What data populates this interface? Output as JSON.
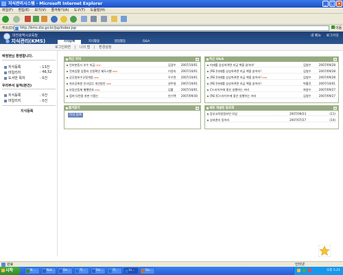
{
  "window": {
    "title": "지식관리시스템 - Microsoft Internet Explorer"
  },
  "menu": [
    "파일(F)",
    "편집(E)",
    "보기(V)",
    "즐겨찾기(A)",
    "도구(T)",
    "도움말(H)"
  ],
  "address": {
    "label": "주소(D)",
    "url": "http://kms.dio.go.kr/jsp/index.jsp",
    "go": "이동"
  },
  "header": {
    "org": "대전광역시교육청",
    "title": "지식관리(KMS)",
    "toplinks": [
      "내 메뉴",
      "로그아웃"
    ],
    "tabs": [
      "지식등록",
      "지식활용",
      "협업활동",
      "Q&A"
    ]
  },
  "subnav": [
    "로그인화면",
    "나의 맵",
    "환경설정"
  ],
  "left": {
    "greeting": "박정현님 환영합니다.",
    "stats": [
      {
        "label": "지식등록",
        "value": ": 13건"
      },
      {
        "label": "마일리지",
        "value": ": 46,52"
      },
      {
        "label": "도서반 목차",
        "value": ": 0건"
      }
    ],
    "section2": "우리부서 실적(본건)",
    "stats2": [
      {
        "label": "지식등록",
        "value": ": 0건"
      },
      {
        "label": "마일리지",
        "value": ": 0건"
      }
    ],
    "button": "지식등록"
  },
  "panels": {
    "recent_knowledge": {
      "title": "최근 지식",
      "rows": [
        {
          "title": "인보본동시 부수 지급",
          "new": "new",
          "author": "김경수",
          "date": "2007/10/01"
        },
        {
          "title": "전자입찰 입찰자 신청확인 제도시행",
          "new": "new",
          "author": "이경숙",
          "date": "2007/10/01"
        },
        {
          "title": "공무원보수규정개정",
          "new": "new",
          "author": "우수련",
          "date": "2007/10/01"
        },
        {
          "title": "자부공위원 인사업무 개선방안",
          "new": "new",
          "author": "권주영",
          "date": "2007/10/01"
        },
        {
          "title": "부동산등재 별행번호",
          "new": "new",
          "author": "김황",
          "date": "2007/10/01"
        },
        {
          "title": "접여 다련용 자판 이용는",
          "new": "",
          "author": "안기백",
          "date": "2007/09/30"
        }
      ]
    },
    "recent_qa": {
      "title": "최근 Q&A",
      "rows": [
        {
          "title": "미래를 상상하려면 지금 책을 읽어라!",
          "new": "",
          "author": "김영수",
          "date": "2007/09/28"
        },
        {
          "title": "[RE:]미래를 상상하려면 지금 책을 읽어라!",
          "new": "",
          "author": "김영수",
          "date": "2007/09/28"
        },
        {
          "title": "[RE:]미래를 상상하려면 지금 책을 읽어라!",
          "new": "new",
          "author": "김영수",
          "date": "2007/09/28"
        },
        {
          "title": "[RE:]미래를 상상하려면 지금 책을 읽어라!",
          "new": "",
          "author": "박황진",
          "date": "2007/10/01"
        },
        {
          "title": "C드라이브에 좋은 실행하는 카비",
          "new": "",
          "author": "최영수",
          "date": "2007/09/27"
        },
        {
          "title": "[RE:]C드라이브에 좋은 실행하는 카비",
          "new": "",
          "author": "김영수",
          "date": "2007/09/27"
        }
      ]
    },
    "quick": {
      "title": "즐겨찾기",
      "button": "지식 등록"
    },
    "cop": {
      "title": "새로 개설된 동호회",
      "rows": [
        {
          "title": "동부교육청정보민 모임",
          "date": "2007/09/23",
          "count": "(11)"
        },
        {
          "title": "성과관리 동아리",
          "date": "2007/07/27",
          "count": "(14)"
        }
      ]
    }
  },
  "statusbar": {
    "done": "완료",
    "zone": "인터넷"
  },
  "taskbar": {
    "start": "시작",
    "tasks": [
      "N...",
      "Nat...",
      "De...",
      "지...",
      "De...",
      "지...",
      "In...",
      "Sa..."
    ],
    "clock": "오후 5:21"
  },
  "colors": {
    "header_bg": "#1f3f74",
    "box_header": "#97ab82",
    "new_badge": "#e04a1a"
  }
}
